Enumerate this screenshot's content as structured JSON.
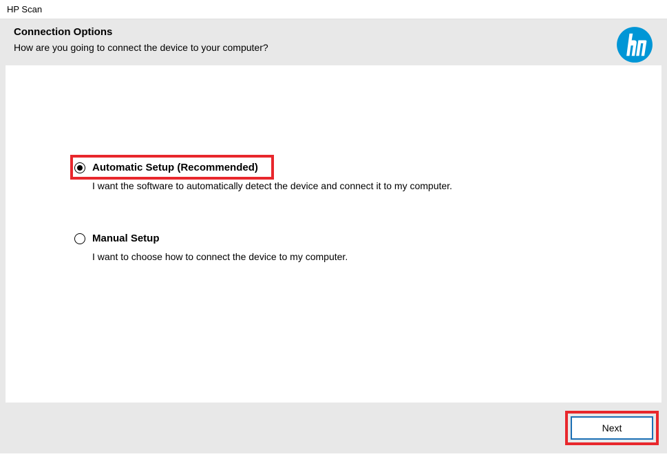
{
  "window": {
    "title": "HP Scan"
  },
  "header": {
    "title": "Connection Options",
    "subtitle": "How are you going to connect the device to your computer?"
  },
  "options": {
    "automatic": {
      "label": "Automatic Setup (Recommended)",
      "description": "I want the software to automatically detect the device and connect it to my computer.",
      "selected": true
    },
    "manual": {
      "label": "Manual Setup",
      "description": "I want to choose how to connect the device to my computer.",
      "selected": false
    }
  },
  "footer": {
    "next_label": "Next"
  },
  "colors": {
    "highlight": "#e8272c",
    "button_border": "#1b6fb5",
    "header_bg": "#e8e8e8",
    "hp_blue": "#0096d6"
  }
}
